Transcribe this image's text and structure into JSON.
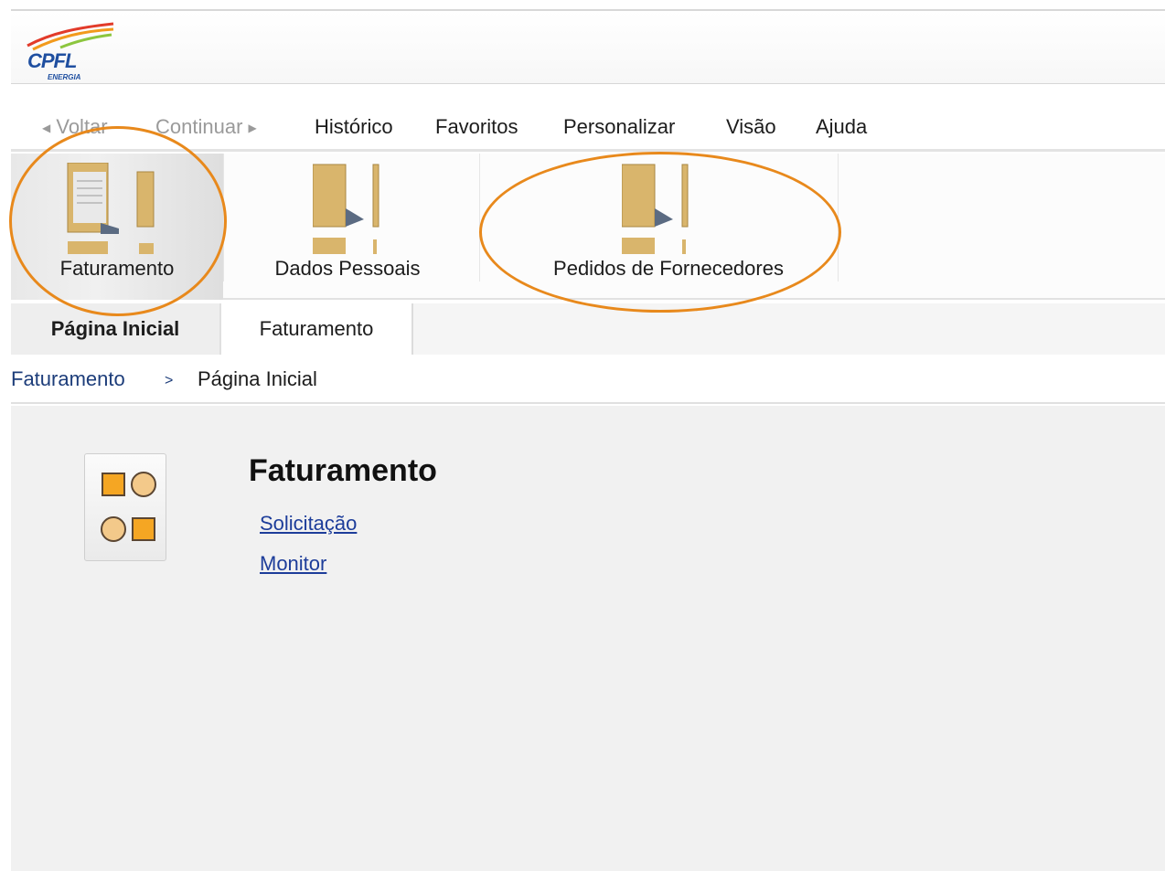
{
  "header": {
    "logo_text": "CPFL",
    "logo_sub": "ENERGIA"
  },
  "menubar": {
    "back": "Voltar",
    "forward": "Continuar",
    "items": [
      "Histórico",
      "Favoritos",
      "Personalizar",
      "Visão",
      "Ajuda"
    ]
  },
  "launchpad": {
    "tiles": [
      {
        "label": "Faturamento",
        "icon": "folder-documents-icon",
        "selected": true
      },
      {
        "label": "Dados Pessoais",
        "icon": "folder-icon",
        "selected": false
      },
      {
        "label": "Pedidos de Fornecedores",
        "icon": "folder-icon",
        "selected": false
      }
    ]
  },
  "tabs": [
    {
      "label": "Página Inicial",
      "active": true
    },
    {
      "label": "Faturamento",
      "active": false
    }
  ],
  "breadcrumb": {
    "parent": "Faturamento",
    "separator": ">",
    "current": "Página Inicial"
  },
  "content": {
    "title": "Faturamento",
    "icon": "app-grid-icon",
    "links": [
      "Solicitação",
      "Monitor"
    ]
  },
  "annotation": {
    "color": "#e8891c"
  }
}
